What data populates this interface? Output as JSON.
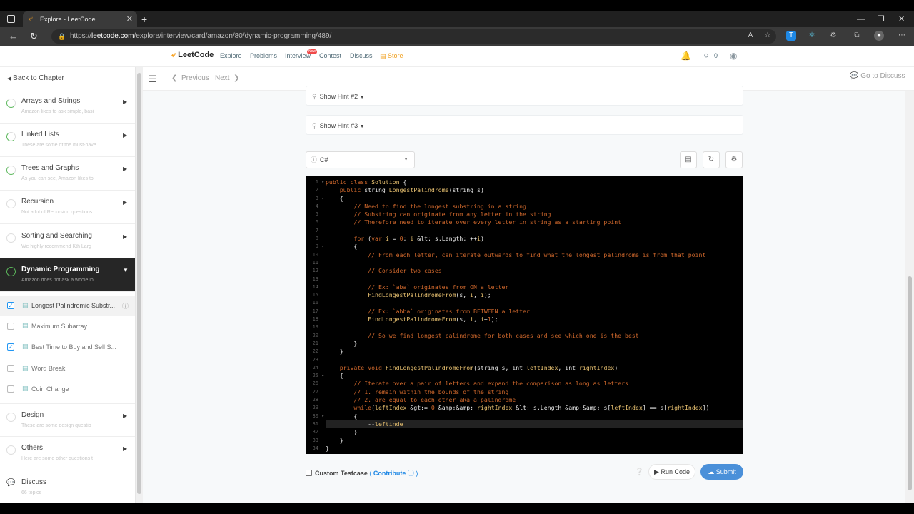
{
  "browser": {
    "tab_title": "Explore - LeetCode",
    "url_prefix": "https://",
    "url_domain": "leetcode.com",
    "url_path": "/explore/interview/card/amazon/80/dynamic-programming/489/"
  },
  "header": {
    "logo": "LeetCode",
    "nav": [
      "Explore",
      "Problems",
      "Interview",
      "Contest",
      "Discuss",
      "Store"
    ],
    "new_badge": "New",
    "coins": "0"
  },
  "sidebar": {
    "back": "Back to Chapter",
    "chapters": [
      {
        "title": "Arrays and Strings",
        "sub": "Amazon likes to ask simple, basi"
      },
      {
        "title": "Linked Lists",
        "sub": "These are some of the must-have"
      },
      {
        "title": "Trees and Graphs",
        "sub": "As you can see, Amazon likes to"
      },
      {
        "title": "Recursion",
        "sub": "Not a lot of Recursion questions"
      },
      {
        "title": "Sorting and Searching",
        "sub": "We highly recommend Kth Larg"
      },
      {
        "title": "Dynamic Programming",
        "sub": "Amazon does not ask a whole lo"
      }
    ],
    "questions": [
      {
        "label": "Longest Palindromic Substr...",
        "checked": true
      },
      {
        "label": "Maximum Subarray",
        "checked": false
      },
      {
        "label": "Best Time to Buy and Sell S...",
        "checked": true
      },
      {
        "label": "Word Break",
        "checked": false
      },
      {
        "label": "Coin Change",
        "checked": false
      }
    ],
    "chapters_after": [
      {
        "title": "Design",
        "sub": "These are some design questio"
      },
      {
        "title": "Others",
        "sub": "Here are some other questions t"
      },
      {
        "title": "Discuss",
        "sub": "66 topics"
      }
    ]
  },
  "content": {
    "previous": "Previous",
    "next": "Next",
    "goto_discuss": "Go to Discuss",
    "hint2": "Show Hint #2",
    "hint3": "Show Hint #3",
    "language": "C#",
    "custom_testcase": "Custom Testcase",
    "contribute": "Contribute",
    "run_code": "Run Code",
    "submit": "Submit"
  },
  "code_lines": [
    "public class Solution {",
    "    public string LongestPalindrome(string s)",
    "    {",
    "        // Need to find the longest substring in a string",
    "        // Substring can originate from any letter in the string",
    "        // Therefore need to iterate over every letter in string as a starting point",
    "",
    "        for (var i = 0; i < s.Length; ++i)",
    "        {",
    "            // From each letter, can iterate outwards to find what the longest palindrome is from that point",
    "",
    "            // Consider two cases",
    "",
    "            // Ex: `aba` originates from ON a letter",
    "            FindLongestPalindromeFrom(s, i, i);",
    "",
    "            // Ex: `abba` originates from BETWEEN a letter",
    "            FindLongestPalindromeFrom(s, i, i+1);",
    "",
    "            // So we find longest palindrome for both cases and see which one is the best",
    "        }",
    "    }",
    "",
    "    private void FindLongestPalindromeFrom(string s, int leftIndex, int rightIndex)",
    "    {",
    "        // Iterate over a pair of letters and expand the comparison as long as letters",
    "        // 1. remain within the bounds of the string",
    "        // 2. are equal to each other aka a palindrome",
    "        while(leftIndex >= 0 && rightIndex < s.Length && s[leftIndex] == s[rightIndex])",
    "        {",
    "            --leftinde",
    "        }",
    "    }",
    "}"
  ],
  "fold_lines": [
    1,
    3,
    9,
    25,
    30
  ],
  "current_line": 31
}
